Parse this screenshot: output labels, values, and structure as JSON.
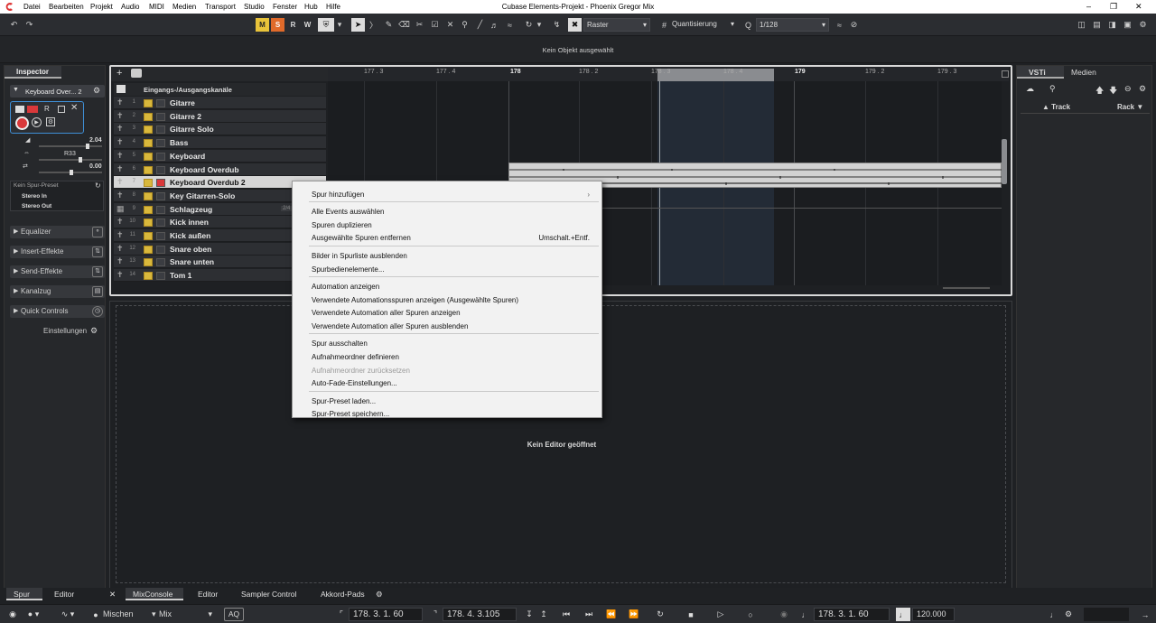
{
  "menubar": {
    "items": [
      "Datei",
      "Bearbeiten",
      "Projekt",
      "Audio",
      "MIDI",
      "Medien",
      "Transport",
      "Studio",
      "Fenster",
      "Hub",
      "Hilfe"
    ],
    "window_title": "Cubase Elements-Projekt - Phoenix Gregor Mix"
  },
  "toolbar": {
    "m_label": "M",
    "s_label": "S",
    "r_label": "R",
    "w_label": "W",
    "grid_mode": "Raster",
    "quantize_mode": "Quantisierung",
    "quantize_value": "1/128"
  },
  "infoline": {
    "text": "Kein Objekt ausgewählt"
  },
  "inspector": {
    "tab_label": "Inspector",
    "track_name": "Keyboard Over... 2",
    "r_label": "R",
    "w_label": "W",
    "volume_value": "2.04",
    "pan_value": "R33",
    "delay_value": "0.00",
    "preset_label": "Kein Spur-Preset",
    "input_routing": "Stereo In",
    "output_routing": "Stereo Out",
    "sections": [
      "Equalizer",
      "Insert-Effekte",
      "Send-Effekte",
      "Kanalzug",
      "Quick Controls"
    ],
    "settings_label": "Einstellungen"
  },
  "project": {
    "folder_label": "Eingangs-/Ausgangskanäle",
    "ruler": [
      "177 . 3",
      "177 . 4",
      "178",
      "178 . 2",
      "178 . 3",
      "178 . 4",
      "179",
      "179 . 2",
      "179 . 3"
    ],
    "tracks": [
      {
        "num": "1",
        "name": "Gitarre"
      },
      {
        "num": "2",
        "name": "Gitarre 2"
      },
      {
        "num": "3",
        "name": "Gitarre Solo"
      },
      {
        "num": "4",
        "name": "Bass"
      },
      {
        "num": "5",
        "name": "Keyboard"
      },
      {
        "num": "6",
        "name": "Keyboard Overdub"
      },
      {
        "num": "7",
        "name": "Keyboard Overdub 2"
      },
      {
        "num": "8",
        "name": "Key Gitarren-Solo"
      },
      {
        "num": "9",
        "name": "Schlagzeug"
      },
      {
        "num": "10",
        "name": "Kick innen"
      },
      {
        "num": "11",
        "name": "Kick außen"
      },
      {
        "num": "12",
        "name": "Snare oben"
      },
      {
        "num": "13",
        "name": "Snare unten"
      },
      {
        "num": "14",
        "name": "Tom 1"
      }
    ],
    "drum_badge": "2/4"
  },
  "context_menu": {
    "items": [
      {
        "label": "Spur hinzufügen",
        "submenu": true
      },
      {
        "label": "Alle Events auswählen"
      },
      {
        "label": "Spuren duplizieren"
      },
      {
        "label": "Ausgewählte Spuren entfernen",
        "shortcut": "Umschalt.+Entf."
      },
      {
        "label": "Bilder in Spurliste ausblenden"
      },
      {
        "label": "Spurbedienelemente..."
      },
      {
        "label": "Automation anzeigen"
      },
      {
        "label": "Verwendete Automationsspuren anzeigen (Ausgewählte Spuren)"
      },
      {
        "label": "Verwendete Automation aller Spuren anzeigen"
      },
      {
        "label": "Verwendete Automation aller Spuren ausblenden"
      },
      {
        "label": "Spur ausschalten"
      },
      {
        "label": "Aufnahmeordner definieren"
      },
      {
        "label": "Aufnahmeordner zurücksetzen",
        "disabled": true
      },
      {
        "label": "Auto-Fade-Einstellungen..."
      },
      {
        "label": "Spur-Preset laden..."
      },
      {
        "label": "Spur-Preset speichern..."
      }
    ]
  },
  "editor": {
    "message": "Kein Editor geöffnet"
  },
  "rightzone": {
    "tabs": [
      "VSTi",
      "Medien"
    ],
    "col_track": "Track",
    "col_rack": "Rack"
  },
  "lower_tabs": {
    "left": [
      "Spur",
      "Editor"
    ],
    "right": [
      "MixConsole",
      "Editor",
      "Sampler Control",
      "Akkord-Pads"
    ]
  },
  "transport": {
    "mix_mode": "Mischen",
    "mix_value": "Mix",
    "aq_label": "AQ",
    "left_locator": "178.  3.  1.  60",
    "right_locator": "178.  4.  3.105",
    "position": "178.  3.  1.  60",
    "tempo": "120.000"
  },
  "colors": {
    "mute": "#e8c33a",
    "solo": "#e06a2a",
    "record": "#d9383a",
    "track_button": "#d9b83c"
  }
}
